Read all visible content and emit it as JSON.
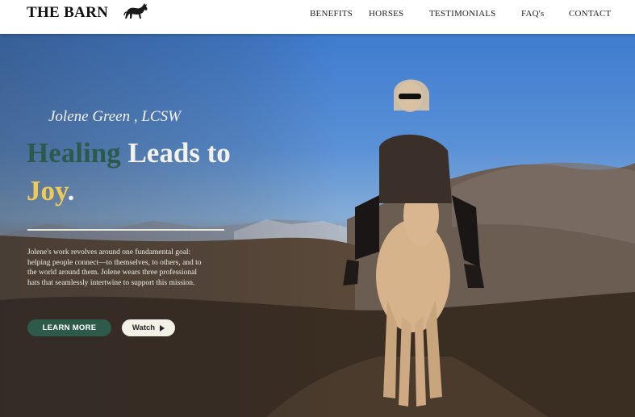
{
  "header": {
    "brand": "THE BARN",
    "nav": [
      "BENEFITS",
      "HORSES",
      "TESTIMONIALS",
      "FAQ's",
      "CONTACT"
    ]
  },
  "hero": {
    "subtitle": "Jolene Green , LCSW",
    "headline": {
      "word1": "Healing",
      "word2": " Leads to",
      "word3": "Joy",
      "word4": "."
    },
    "body_lines": [
      "Jolene's work revolves around one fundamental goal:",
      "helping  people connect—to themselves, to others, and to",
      "the world around them.  Jolene wears three professional",
      "hats that seamlessly intertwine to support this mission."
    ],
    "learn_more": "LEARN MORE",
    "watch": "Watch"
  },
  "colors": {
    "accent_green": "#2d5a4b",
    "accent_yellow": "#f1c955",
    "cream": "#f3f1e7"
  },
  "icons": [
    "horse-logo-icon",
    "play-icon"
  ]
}
